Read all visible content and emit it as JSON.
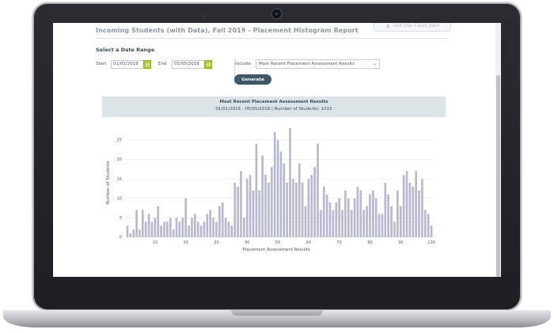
{
  "report": {
    "title": "Incoming Students (with Data), Fall 2019 - Placement Histogram Report",
    "export_label": "Use Use Clean data"
  },
  "date_range": {
    "heading": "Select a Date Range",
    "start_label": "Start",
    "start_value": "01/01/2016",
    "end_label": "End",
    "end_value": "05/05/2018"
  },
  "include": {
    "label": "Include",
    "selected": "Most Recent Placement Assessment Results"
  },
  "generate_label": "Generate",
  "chart_data": {
    "type": "bar",
    "title": "Most Recent Placement Assessment Results",
    "subtitle": "01/01/2016 - 05/05/2018 | Number of Students: 1015",
    "xlabel": "Placement Assessment Results",
    "ylabel": "Number of Students",
    "xlim": [
      0,
      100
    ],
    "ylim": [
      0,
      28
    ],
    "x_ticks": [
      10,
      20,
      30,
      40,
      50,
      60,
      70,
      80,
      90,
      100
    ],
    "y_ticks": [
      0,
      5,
      10,
      15,
      20,
      25
    ],
    "grid": true,
    "bar_color": "#b9b8d1",
    "x": [
      1,
      2,
      3,
      4,
      5,
      6,
      7,
      8,
      9,
      10,
      11,
      12,
      13,
      14,
      15,
      16,
      17,
      18,
      19,
      20,
      21,
      22,
      23,
      24,
      25,
      26,
      27,
      28,
      29,
      30,
      31,
      32,
      33,
      34,
      35,
      36,
      37,
      38,
      39,
      40,
      41,
      42,
      43,
      44,
      45,
      46,
      47,
      48,
      49,
      50,
      51,
      52,
      53,
      54,
      55,
      56,
      57,
      58,
      59,
      60,
      61,
      62,
      63,
      64,
      65,
      66,
      67,
      68,
      69,
      70,
      71,
      72,
      73,
      74,
      75,
      76,
      77,
      78,
      79,
      80,
      81,
      82,
      83,
      84,
      85,
      86,
      87,
      88,
      89,
      90,
      91,
      92,
      93,
      94,
      95,
      96,
      97,
      98,
      99,
      100
    ],
    "values": [
      3,
      1,
      2,
      7,
      2,
      7,
      4,
      6,
      4,
      5,
      8,
      3,
      4,
      4,
      5,
      2,
      5,
      4,
      5,
      10,
      3,
      5,
      6,
      4,
      3,
      4,
      6,
      7,
      5,
      4,
      8,
      9,
      5,
      4,
      3,
      14,
      13,
      17,
      5,
      15,
      16,
      12,
      24,
      12,
      21,
      16,
      14,
      18,
      27,
      25,
      22,
      19,
      14,
      28,
      15,
      14,
      19,
      14,
      8,
      15,
      16,
      18,
      24,
      7,
      13,
      11,
      9,
      7,
      9,
      10,
      7,
      12,
      10,
      7,
      10,
      13,
      12,
      7,
      8,
      11,
      12,
      10,
      6,
      6,
      14,
      11,
      8,
      4,
      12,
      8,
      16,
      17,
      14,
      13,
      17,
      12,
      15,
      7,
      6,
      3
    ]
  }
}
